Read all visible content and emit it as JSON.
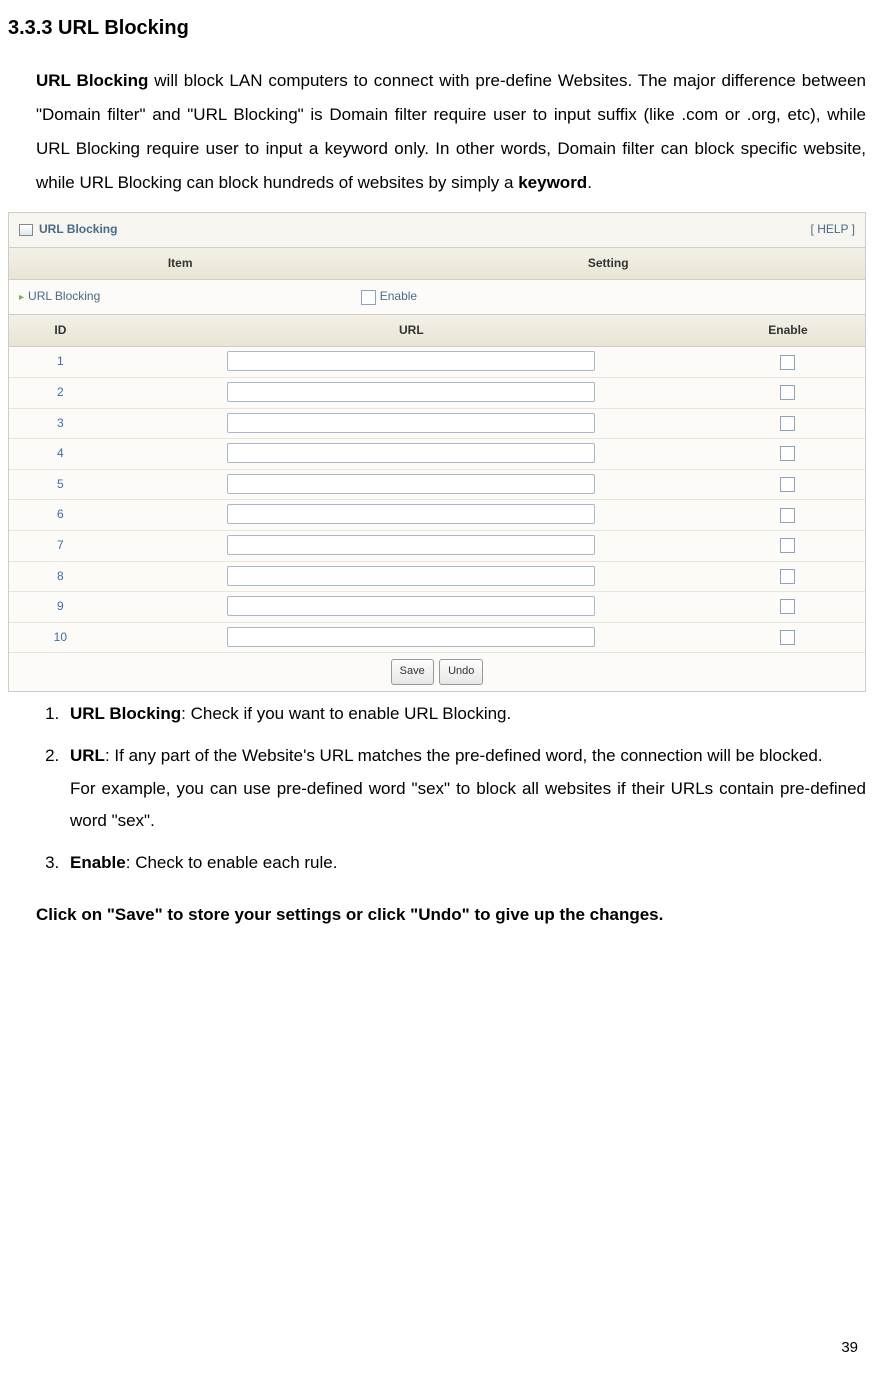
{
  "heading": "3.3.3 URL Blocking",
  "intro_parts": {
    "p1_a": "URL Blocking",
    "p1_b": " will block LAN computers to connect with pre-define Websites. The major difference between \"Domain filter\" and \"URL Blocking\" is Domain filter require user to input suffix (like .com or .org, etc), while URL Blocking require user to input a keyword only. In other words, Domain filter can block specific website, while URL Blocking can block hundreds of websites by simply a ",
    "p1_c": "keyword",
    "p1_d": "."
  },
  "panel": {
    "title": "URL Blocking",
    "help": "[ HELP ]",
    "item_header": "Item",
    "setting_header": "Setting",
    "row_label": "URL Blocking",
    "enable_label": "Enable"
  },
  "url_table": {
    "id_header": "ID",
    "url_header": "URL",
    "enable_header": "Enable",
    "rows": [
      {
        "id": "1"
      },
      {
        "id": "2"
      },
      {
        "id": "3"
      },
      {
        "id": "4"
      },
      {
        "id": "5"
      },
      {
        "id": "6"
      },
      {
        "id": "7"
      },
      {
        "id": "8"
      },
      {
        "id": "9"
      },
      {
        "id": "10"
      }
    ]
  },
  "buttons": {
    "save": "Save",
    "undo": "Undo"
  },
  "list": {
    "item1_b": "URL Blocking",
    "item1_t": ": Check if you want to enable URL Blocking.",
    "item2_b": "URL",
    "item2_t1": ": If any part of the Website's URL matches the pre-defined word, the connection will be blocked.",
    "item2_t2": "For example, you can use pre-defined word \"sex\" to block all websites if their URLs contain pre-defined word \"sex\".",
    "item3_b": "Enable",
    "item3_t": ": Check to enable each rule."
  },
  "closing": "Click on \"Save\" to store your settings or click \"Undo\" to give up the changes.",
  "page_number": "39"
}
